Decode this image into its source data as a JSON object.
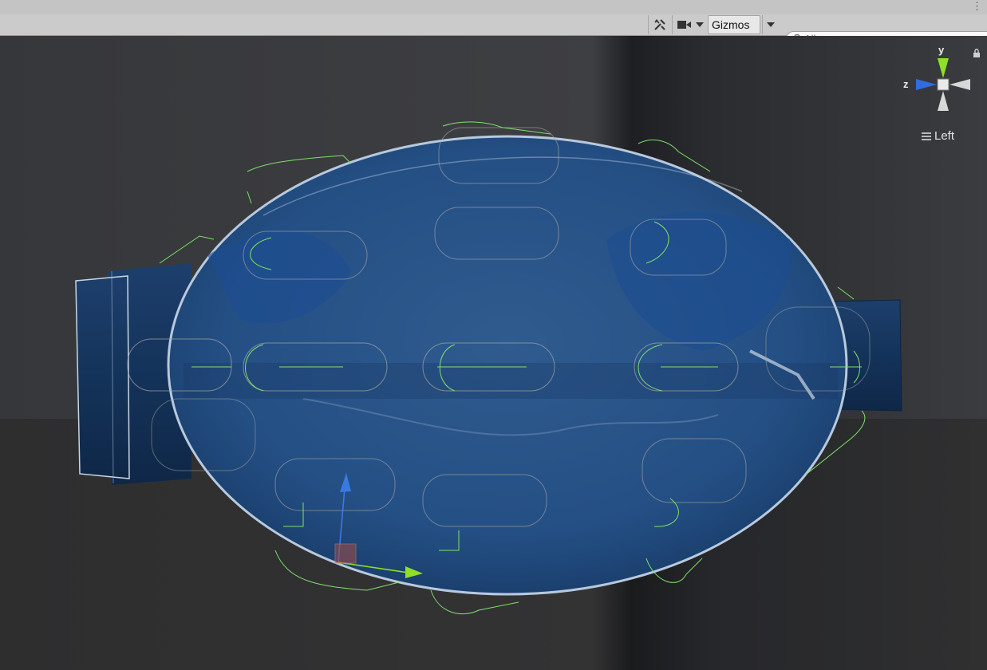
{
  "toolbar": {
    "gizmos_label": "Gizmos",
    "search_placeholder": "All"
  },
  "scene_gizmo": {
    "axis_y": "y",
    "axis_z": "z",
    "view_name": "Left"
  },
  "colors": {
    "axis_y": "#8fe027",
    "axis_z": "#2f6de0",
    "collider_wire": "#7fe06a",
    "bottle": "#1e4a80"
  },
  "icons": [
    "tools-icon",
    "camera-icon",
    "dropdown-icon",
    "search-icon",
    "lock-icon",
    "hamburger-icon"
  ]
}
